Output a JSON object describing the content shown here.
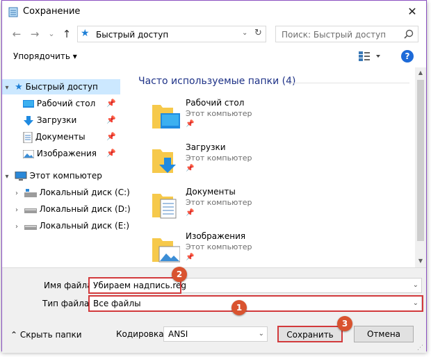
{
  "window": {
    "title": "Сохранение",
    "close_glyph": "✕"
  },
  "nav": {
    "back_glyph": "←",
    "forward_glyph": "→",
    "recent_glyph": "⌄",
    "up_glyph": "↑",
    "address": "Быстрый доступ",
    "search_placeholder": "Поиск: Быстрый доступ"
  },
  "toolbar": {
    "organize_label": "Упорядочить ▾",
    "help_label": "?"
  },
  "sidebar": {
    "quick_access": "Быстрый доступ",
    "items": [
      {
        "label": "Рабочий стол",
        "icon": "desktop-icon"
      },
      {
        "label": "Загрузки",
        "icon": "downloads-icon"
      },
      {
        "label": "Документы",
        "icon": "documents-icon"
      },
      {
        "label": "Изображения",
        "icon": "pictures-icon"
      }
    ],
    "this_pc": "Этот компьютер",
    "drives": [
      {
        "label": "Локальный диск (C:)"
      },
      {
        "label": "Локальный диск (D:)"
      },
      {
        "label": "Локальный диск (E:)"
      }
    ]
  },
  "content": {
    "section_title": "Часто используемые папки (4)",
    "tiles": [
      {
        "name": "Рабочий стол",
        "sub": "Этот компьютер",
        "overlay": "desktop"
      },
      {
        "name": "Загрузки",
        "sub": "Этот компьютер",
        "overlay": "download"
      },
      {
        "name": "Документы",
        "sub": "Этот компьютер",
        "overlay": "document"
      },
      {
        "name": "Изображения",
        "sub": "Этот компьютер",
        "overlay": "picture"
      }
    ]
  },
  "form": {
    "filename_label": "Имя файла:",
    "filename_value": "Убираем надпись.reg",
    "filetype_label": "Тип файла:",
    "filetype_value": "Все файлы",
    "encoding_label": "Кодировка:",
    "encoding_value": "ANSI",
    "save_label": "Сохранить",
    "cancel_label": "Отмена",
    "hide_folders_label": "Скрыть папки"
  },
  "annotations": {
    "badge1": "1",
    "badge2": "2",
    "badge3": "3"
  },
  "colors": {
    "accent": "#8a4fc1",
    "highlight": "#d2393b",
    "badge": "#d9532f",
    "selection": "#cce8ff"
  }
}
